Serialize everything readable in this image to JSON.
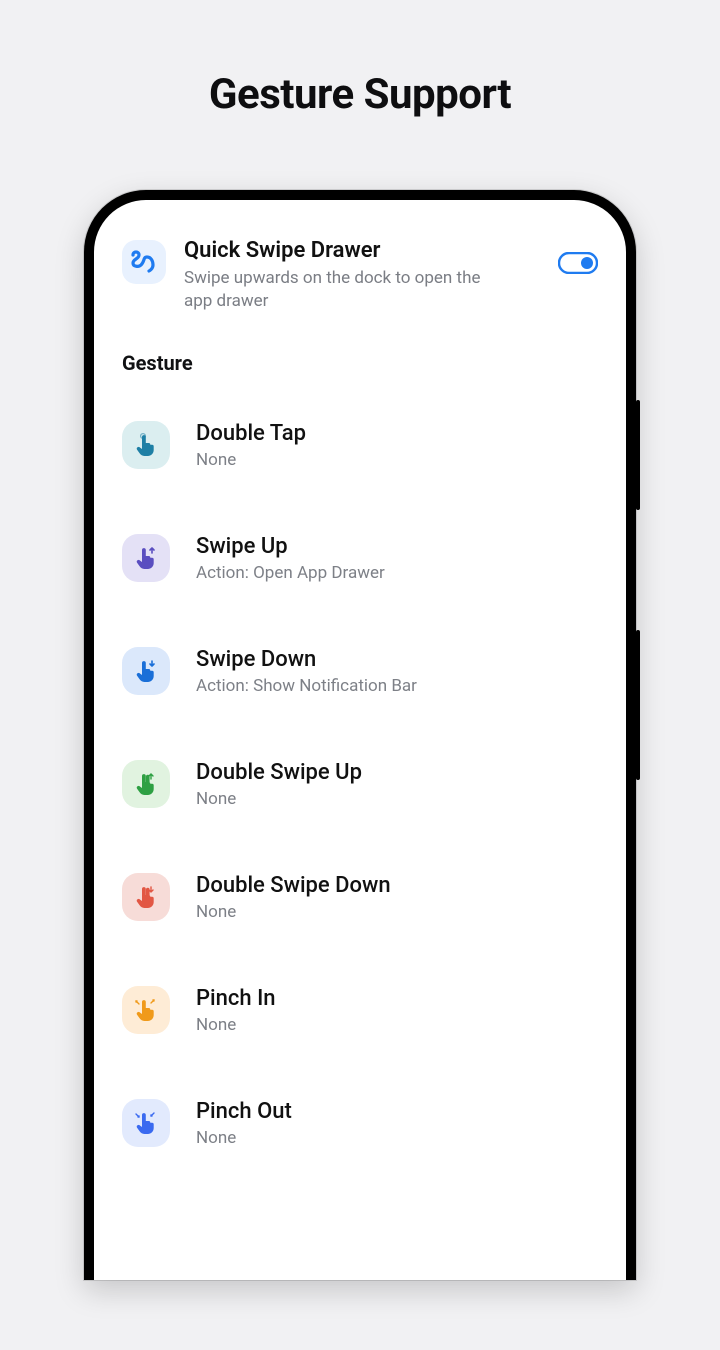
{
  "page_title": "Gesture Support",
  "feature": {
    "title": "Quick Swipe Drawer",
    "subtitle": "Swipe upwards on the dock to open the app drawer",
    "enabled": true
  },
  "section_label": "Gesture",
  "gestures": [
    {
      "title": "Double Tap",
      "subtitle": "None",
      "icon": "tap",
      "tile": "teal",
      "fg": "#1e7fa5"
    },
    {
      "title": "Swipe Up",
      "subtitle": "Action: Open App Drawer",
      "icon": "swipe-up",
      "tile": "violet",
      "fg": "#5a4ec0"
    },
    {
      "title": "Swipe Down",
      "subtitle": "Action: Show Notification Bar",
      "icon": "swipe-down",
      "tile": "blue",
      "fg": "#1a6fd8"
    },
    {
      "title": "Double Swipe Up",
      "subtitle": "None",
      "icon": "two-up",
      "tile": "green",
      "fg": "#2ea043"
    },
    {
      "title": "Double Swipe Down",
      "subtitle": "None",
      "icon": "two-down",
      "tile": "red",
      "fg": "#e25744"
    },
    {
      "title": "Pinch In",
      "subtitle": "None",
      "icon": "pinch-in",
      "tile": "orange",
      "fg": "#f09a1a"
    },
    {
      "title": "Pinch Out",
      "subtitle": "None",
      "icon": "pinch-out",
      "tile": "lblue",
      "fg": "#3a6af0"
    }
  ]
}
